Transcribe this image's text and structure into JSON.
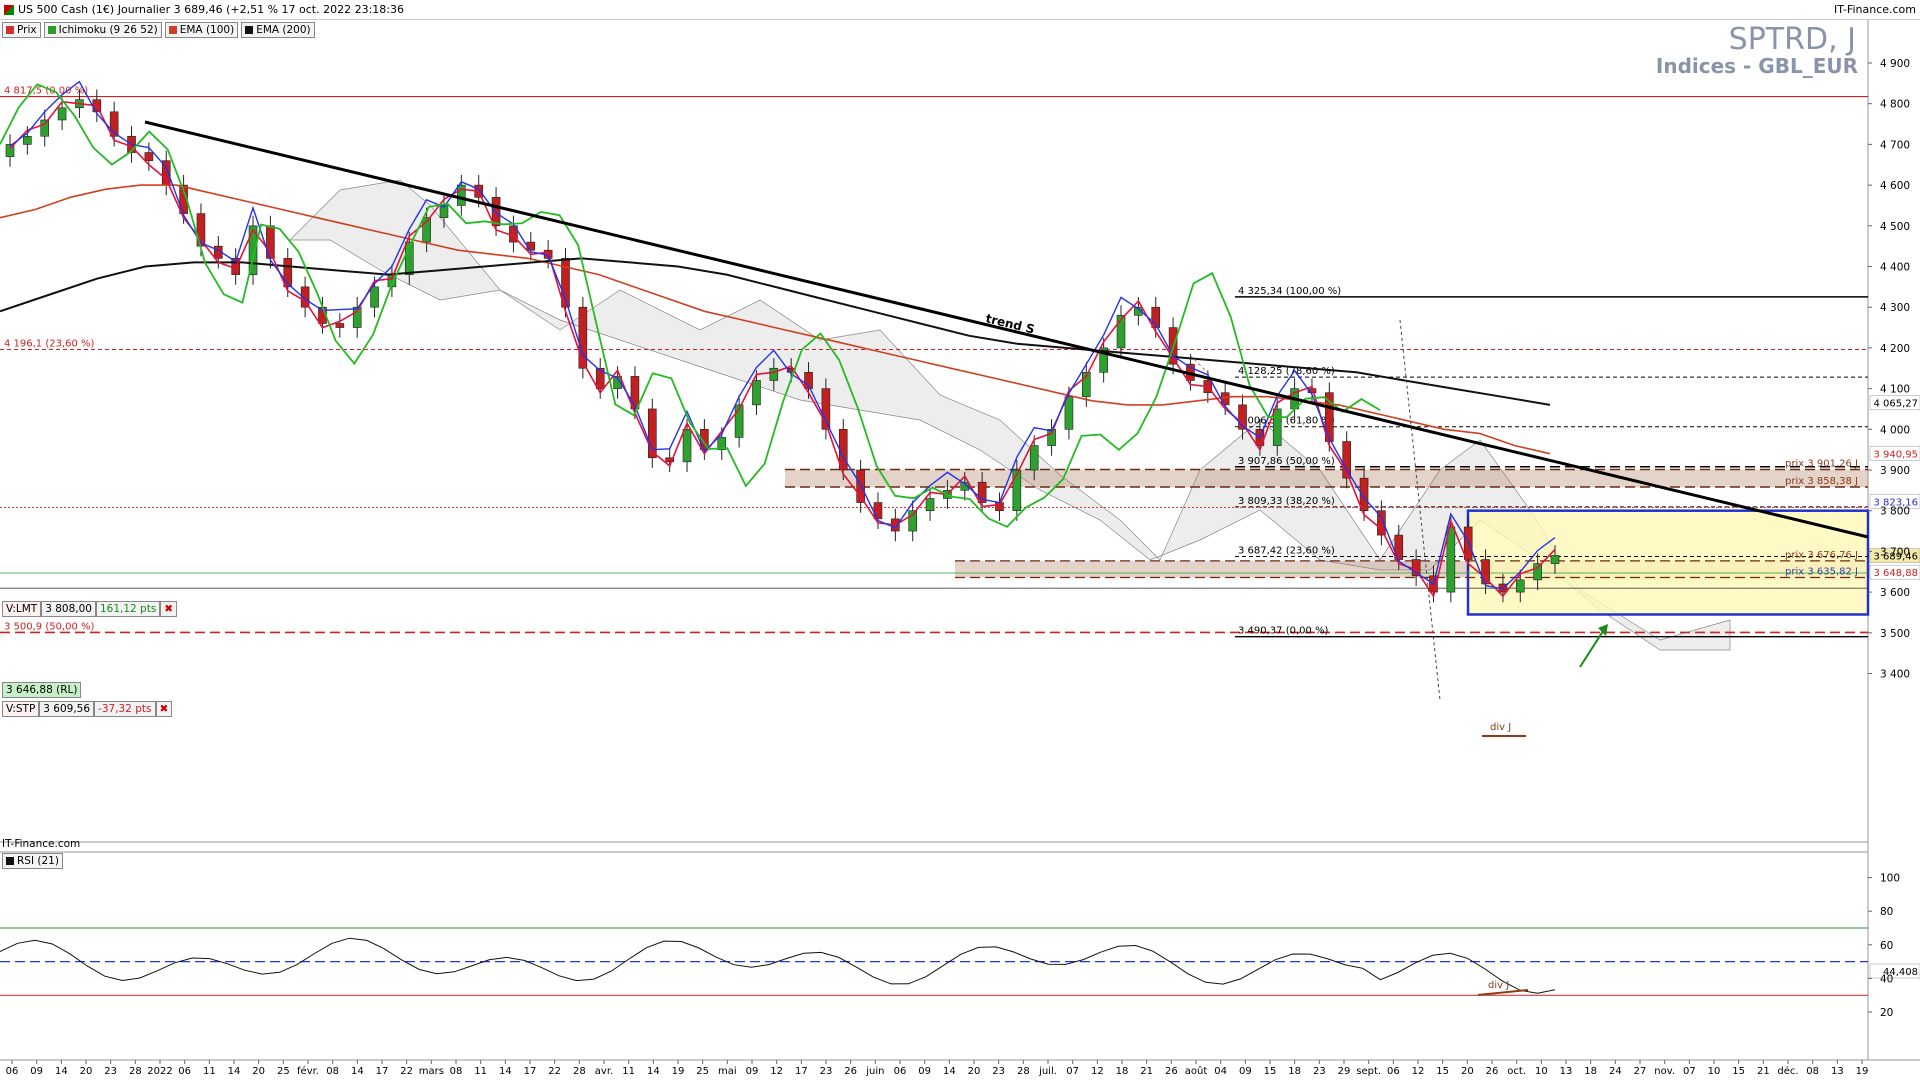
{
  "window": {
    "title": "US 500 Cash (1€) Journalier 3 689,46 (+2,51 % 17 oct. 2022 23:18:36",
    "brand": "IT-Finance.com"
  },
  "legend": [
    {
      "label": "Prix",
      "color": "#cc3333"
    },
    {
      "label": "Ichimoku (9 26 52)",
      "color": "#2a9d2a"
    },
    {
      "label": "EMA (100)",
      "color": "#d04020"
    },
    {
      "label": "EMA (200)",
      "color": "#111111"
    }
  ],
  "symbol": {
    "name": "SPTRD, J",
    "subtitle": "Indices - GBL_EUR"
  },
  "orders": {
    "lmt": {
      "label": "V:LMT",
      "price": "3 808,00",
      "dist": "161,12 pts"
    },
    "stp": {
      "label": "V:STP",
      "price": "3 609,56",
      "dist": "-37,32 pts"
    },
    "rl": {
      "label": "3 646,88 (RL)"
    }
  },
  "price_tags": [
    {
      "text": "4 065,27",
      "color": "#000000",
      "bg": "#ffffff",
      "value": 4065.27
    },
    {
      "text": "3 940,95",
      "color": "#cc2222",
      "bg": "#ffffff",
      "value": 3940.95
    },
    {
      "text": "3 823,16",
      "color": "#2233cc",
      "bg": "#ffffff",
      "value": 3823.16
    },
    {
      "text": "3 689,46",
      "color": "#000000",
      "bg": "#f5e9a8",
      "value": 3689.46
    },
    {
      "text": "3 648,88",
      "color": "#cc2222",
      "bg": "#ffffff",
      "value": 3648.88
    }
  ],
  "levels": [
    {
      "text": "4 817,5 (0,00 %)",
      "value": 4817.5,
      "color": "#cc2222"
    },
    {
      "text": "4 196,1 (23,60 %)",
      "value": 4196.1,
      "color": "#cc2222"
    },
    {
      "text": "3 500,9 (50,00 %)",
      "value": 3500.9,
      "color": "#cc2222"
    },
    {
      "text": "4 325,34 (100,00 %)",
      "value": 4325.34,
      "color": "#000000"
    },
    {
      "text": "4 128,25 (78,60 %)",
      "value": 4128.25,
      "color": "#000000"
    },
    {
      "text": "4 006,38 (61,80 %)",
      "value": 4006.38,
      "color": "#000000"
    },
    {
      "text": "3 907,86 (50,00 %)",
      "value": 3907.86,
      "color": "#000000"
    },
    {
      "text": "3 809,33 (38,20 %)",
      "value": 3809.33,
      "color": "#000000"
    },
    {
      "text": "3 687,42 (23,60 %)",
      "value": 3687.42,
      "color": "#000000"
    },
    {
      "text": "3 490,37 (0,00 %)",
      "value": 3490.37,
      "color": "#000000"
    }
  ],
  "zones": [
    {
      "text": "prix 3 901,26 J",
      "value": 3901.26,
      "color": "#8b3a1a"
    },
    {
      "text": "prix 3 858,38 J",
      "value": 3858.38,
      "color": "#8b3a1a"
    },
    {
      "text": "prix 3 676,76 J",
      "value": 3676.76,
      "color": "#8b3a1a"
    },
    {
      "text": "prix 3 635,82 J",
      "value": 3635.82,
      "color": "#3344aa"
    }
  ],
  "annotations": {
    "trend": "trend S",
    "div": "div J",
    "div_rsi": "div J"
  },
  "rsi": {
    "label": "RSI (21)",
    "value_tag": "44,408",
    "value": 44.408
  },
  "chart_data": {
    "type": "line",
    "title": "SPTRD, J",
    "y_axis": {
      "ticks": [
        "4 900",
        "4 800",
        "4 700",
        "4 600",
        "4 500",
        "4 400",
        "4 300",
        "4 200",
        "4 100",
        "4 000",
        "3 900",
        "3 800",
        "3 700",
        "3 600",
        "3 500",
        "3 400"
      ],
      "ylim": [
        3350,
        4950
      ]
    },
    "rsi_axis": {
      "ticks": [
        "100",
        "80",
        "60",
        "40",
        "20"
      ],
      "levels": [
        30,
        50,
        70
      ]
    },
    "x_ticks": [
      "06",
      "09",
      "14",
      "20",
      "23",
      "28",
      "2022",
      "06",
      "11",
      "14",
      "20",
      "25",
      "févr.",
      "08",
      "14",
      "17",
      "22",
      "mars",
      "08",
      "11",
      "14",
      "17",
      "22",
      "28",
      "avr.",
      "11",
      "14",
      "19",
      "25",
      "mai",
      "09",
      "12",
      "17",
      "23",
      "26",
      "juin",
      "06",
      "09",
      "14",
      "20",
      "23",
      "28",
      "juil.",
      "07",
      "12",
      "18",
      "21",
      "26",
      "août",
      "04",
      "09",
      "15",
      "18",
      "23",
      "29",
      "sept.",
      "06",
      "12",
      "15",
      "20",
      "26",
      "oct.",
      "10",
      "13",
      "18",
      "24",
      "27",
      "nov.",
      "07",
      "10",
      "15",
      "21",
      "déc.",
      "08",
      "13",
      "19"
    ],
    "series": [
      {
        "name": "Prix",
        "values": [
          4700,
          4720,
          4760,
          4790,
          4810,
          4780,
          4720,
          4680,
          4660,
          4600,
          4530,
          4450,
          4420,
          4380,
          4500,
          4420,
          4350,
          4300,
          4260,
          4250,
          4300,
          4350,
          4380,
          4460,
          4520,
          4550,
          4600,
          4570,
          4500,
          4460,
          4440,
          4420,
          4300,
          4150,
          4100,
          4130,
          4050,
          3930,
          3920,
          4000,
          3950,
          3980,
          4060,
          4120,
          4150,
          4140,
          4100,
          4000,
          3900,
          3820,
          3780,
          3750,
          3800,
          3830,
          3850,
          3870,
          3820,
          3800,
          3900,
          3960,
          4000,
          4080,
          4140,
          4200,
          4280,
          4300,
          4250,
          4160,
          4120,
          4090,
          4060,
          4000,
          3960,
          4050,
          4100,
          4090,
          3970,
          3880,
          3800,
          3740,
          3680,
          3640,
          3600,
          3760,
          3680,
          3620,
          3600,
          3630,
          3670,
          3690
        ]
      },
      {
        "name": "EMA (100)",
        "values": [
          4520,
          4540,
          4570,
          4590,
          4600,
          4600,
          4580,
          4560,
          4540,
          4520,
          4500,
          4480,
          4460,
          4440,
          4430,
          4420,
          4400,
          4380,
          4350,
          4320,
          4290,
          4270,
          4250,
          4230,
          4210,
          4190,
          4170,
          4150,
          4130,
          4110,
          4090,
          4070,
          4060,
          4060,
          4070,
          4080,
          4080,
          4070,
          4060,
          4040,
          4020,
          4000,
          3990,
          3960,
          3940
        ]
      },
      {
        "name": "EMA (200)",
        "values": [
          4290,
          4330,
          4370,
          4400,
          4410,
          4410,
          4400,
          4390,
          4380,
          4390,
          4400,
          4410,
          4420,
          4410,
          4400,
          4380,
          4350,
          4320,
          4290,
          4260,
          4230,
          4210,
          4200,
          4190,
          4180,
          4170,
          4160,
          4150,
          4140,
          4120,
          4100,
          4080,
          4060
        ]
      }
    ]
  }
}
